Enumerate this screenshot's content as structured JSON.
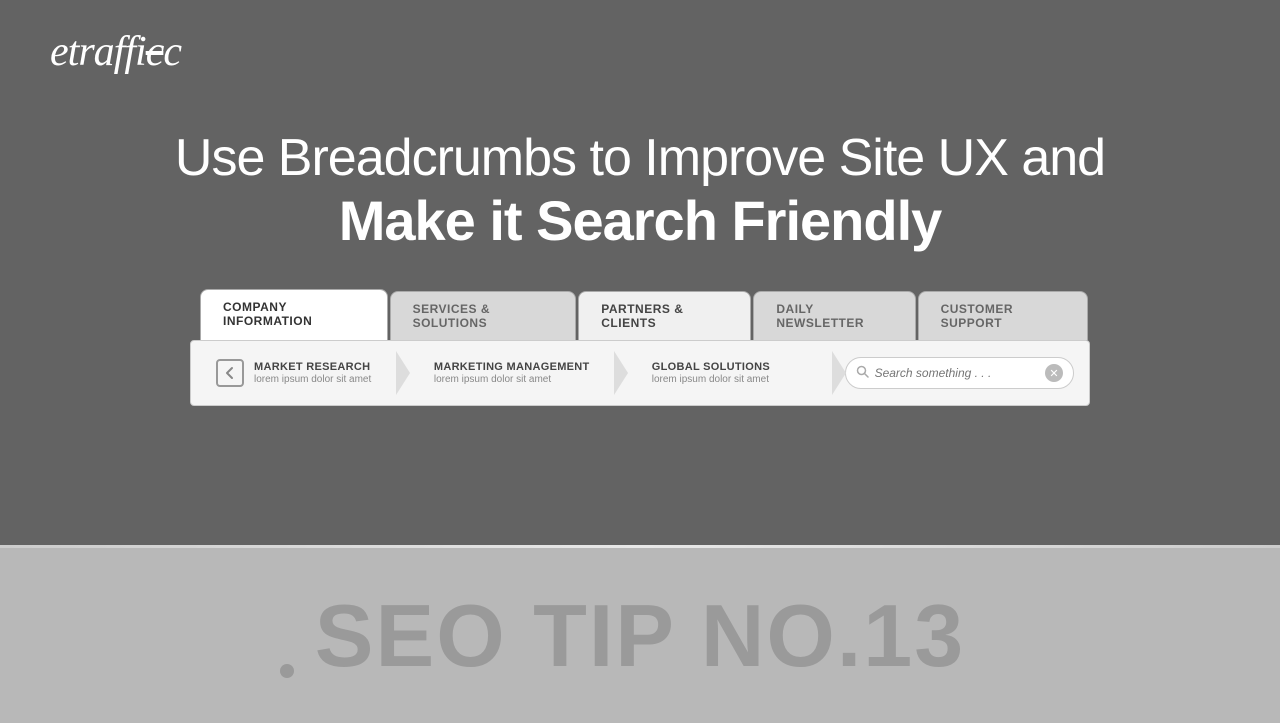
{
  "logo": {
    "text": "etraffic"
  },
  "headline": {
    "line1": "Use Breadcrumbs to Improve Site UX and",
    "line2": "Make it Search Friendly"
  },
  "tabs": [
    {
      "id": "company-info",
      "label": "COMPANY INFORMATION",
      "active": true
    },
    {
      "id": "services-solutions",
      "label": "SERVICES & SOLUTIONS",
      "active": false
    },
    {
      "id": "partners-clients",
      "label": "PARTNERS & CLIENTS",
      "active": false
    },
    {
      "id": "daily-newsletter",
      "label": "DAILY NEWSLETTER",
      "active": false
    },
    {
      "id": "customer-support",
      "label": "CUSTOMER SUPPORT",
      "active": false
    }
  ],
  "breadcrumbs": [
    {
      "id": "market-research",
      "title": "MARKET RESEARCH",
      "subtitle": "lorem ipsum dolor sit amet",
      "hasIcon": true
    },
    {
      "id": "marketing-management",
      "title": "MARKETING MANAGEMENT",
      "subtitle": "lorem ipsum dolor sit amet",
      "hasIcon": false
    },
    {
      "id": "global-solutions",
      "title": "GLOBAL SOLUTIONS",
      "subtitle": "lorem ipsum dolor sit amet",
      "hasIcon": false
    }
  ],
  "search": {
    "placeholder": "Search something . . ."
  },
  "seo_tip": {
    "text": "SEO TIP NO.13"
  }
}
